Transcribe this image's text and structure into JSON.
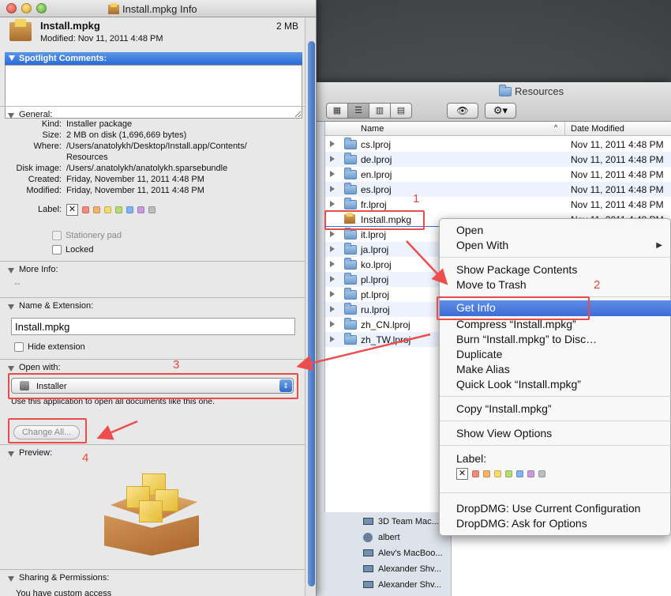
{
  "info_window": {
    "title": "Install.mpkg Info",
    "file_name": "Install.mpkg",
    "modified": "Modified: Nov 11, 2011 4:48 PM",
    "size_short": "2 MB",
    "spotlight_title": "Spotlight Comments:",
    "general": {
      "title": "General:",
      "rows": [
        {
          "key": "Kind:",
          "value": "Installer package"
        },
        {
          "key": "Size:",
          "value": "2 MB on disk (1,696,669 bytes)"
        },
        {
          "key": "Where:",
          "value": "/Users/anatolykh/Desktop/Install.app/Contents/"
        },
        {
          "key": "",
          "value": "Resources"
        },
        {
          "key": "Disk image:",
          "value": "/Users/.anatolykh/anatolykh.sparsebundle"
        },
        {
          "key": "Created:",
          "value": "Friday, November 11, 2011 4:48 PM"
        },
        {
          "key": "Modified:",
          "value": "Friday, November 11, 2011 4:48 PM"
        }
      ],
      "label_key": "Label:",
      "label_x": "✕",
      "stationery": "Stationery pad",
      "locked": "Locked"
    },
    "more_info": {
      "title": "More Info:",
      "value": "--"
    },
    "name_ext": {
      "title": "Name & Extension:",
      "value": "Install.mpkg",
      "hide_ext": "Hide extension"
    },
    "open_with": {
      "title": "Open with:",
      "app": "Installer",
      "note": "Use this application to open all documents like this one.",
      "change_all": "Change All..."
    },
    "preview": {
      "title": "Preview:"
    },
    "sharing": {
      "title": "Sharing & Permissions:",
      "note": "You have custom access"
    }
  },
  "finder": {
    "title": "Resources",
    "col_name": "Name",
    "col_date": "Date Modified",
    "rows": [
      {
        "name": "cs.lproj",
        "date": "Nov 11, 2011 4:48 PM"
      },
      {
        "name": "de.lproj",
        "date": "Nov 11, 2011 4:48 PM"
      },
      {
        "name": "en.lproj",
        "date": "Nov 11, 2011 4:48 PM"
      },
      {
        "name": "es.lproj",
        "date": "Nov 11, 2011 4:48 PM"
      },
      {
        "name": "fr.lproj",
        "date": "Nov 11, 2011 4:48 PM"
      },
      {
        "name": "Install.mpkg",
        "date": "Nov 11, 2011 4:48 PM"
      },
      {
        "name": "it.lproj",
        "date": ""
      },
      {
        "name": "ja.lproj",
        "date": ""
      },
      {
        "name": "ko.lproj",
        "date": ""
      },
      {
        "name": "pl.lproj",
        "date": ""
      },
      {
        "name": "pt.lproj",
        "date": ""
      },
      {
        "name": "ru.lproj",
        "date": ""
      },
      {
        "name": "zh_CN.lproj",
        "date": ""
      },
      {
        "name": "zh_TW.lproj",
        "date": ""
      }
    ],
    "shared": [
      {
        "name": "3D Team Mac...",
        "icon": "computer-icon"
      },
      {
        "name": "albert",
        "icon": "person-icon"
      },
      {
        "name": "Alev's MacBoo...",
        "icon": "computer-icon"
      },
      {
        "name": "Alexander Shv...",
        "icon": "computer-icon"
      },
      {
        "name": "Alexander Shv...",
        "icon": "computer-icon"
      }
    ]
  },
  "context_menu": {
    "open": "Open",
    "open_with": "Open With",
    "show_package": "Show Package Contents",
    "move_trash": "Move to Trash",
    "get_info": "Get Info",
    "compress": "Compress “Install.mpkg”",
    "burn": "Burn “Install.mpkg” to Disc…",
    "duplicate": "Duplicate",
    "make_alias": "Make Alias",
    "quick_look": "Quick Look “Install.mpkg”",
    "copy": "Copy “Install.mpkg”",
    "view_options": "Show View Options",
    "label": "Label:",
    "dropdmg_current": "DropDMG: Use Current Configuration",
    "dropdmg_ask": "DropDMG: Ask for Options"
  },
  "annotations": {
    "n1": "1",
    "n2": "2",
    "n3": "3",
    "n4": "4"
  },
  "colors": {
    "annotation": "#e94b4b",
    "highlight": "#3c6cd6",
    "label_colors": [
      "#f58a7a",
      "#f5b26a",
      "#f3dc6b",
      "#b5dc72",
      "#7fb5f0",
      "#c99ae0",
      "#bdbdbd"
    ]
  }
}
